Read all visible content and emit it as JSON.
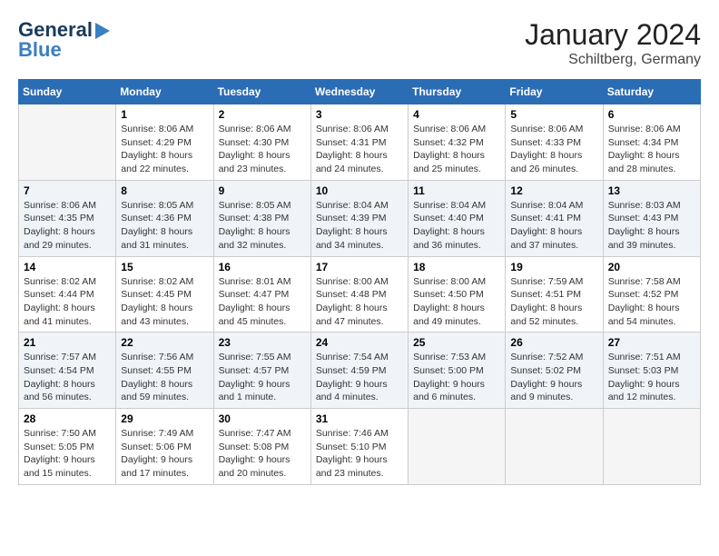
{
  "header": {
    "logo_line1": "General",
    "logo_line2": "Blue",
    "month_title": "January 2024",
    "location": "Schiltberg, Germany"
  },
  "days_of_week": [
    "Sunday",
    "Monday",
    "Tuesday",
    "Wednesday",
    "Thursday",
    "Friday",
    "Saturday"
  ],
  "weeks": [
    [
      {
        "day": "",
        "sunrise": "",
        "sunset": "",
        "daylight": "",
        "empty": true
      },
      {
        "day": "1",
        "sunrise": "Sunrise: 8:06 AM",
        "sunset": "Sunset: 4:29 PM",
        "daylight": "Daylight: 8 hours and 22 minutes."
      },
      {
        "day": "2",
        "sunrise": "Sunrise: 8:06 AM",
        "sunset": "Sunset: 4:30 PM",
        "daylight": "Daylight: 8 hours and 23 minutes."
      },
      {
        "day": "3",
        "sunrise": "Sunrise: 8:06 AM",
        "sunset": "Sunset: 4:31 PM",
        "daylight": "Daylight: 8 hours and 24 minutes."
      },
      {
        "day": "4",
        "sunrise": "Sunrise: 8:06 AM",
        "sunset": "Sunset: 4:32 PM",
        "daylight": "Daylight: 8 hours and 25 minutes."
      },
      {
        "day": "5",
        "sunrise": "Sunrise: 8:06 AM",
        "sunset": "Sunset: 4:33 PM",
        "daylight": "Daylight: 8 hours and 26 minutes."
      },
      {
        "day": "6",
        "sunrise": "Sunrise: 8:06 AM",
        "sunset": "Sunset: 4:34 PM",
        "daylight": "Daylight: 8 hours and 28 minutes."
      }
    ],
    [
      {
        "day": "7",
        "sunrise": "Sunrise: 8:06 AM",
        "sunset": "Sunset: 4:35 PM",
        "daylight": "Daylight: 8 hours and 29 minutes."
      },
      {
        "day": "8",
        "sunrise": "Sunrise: 8:05 AM",
        "sunset": "Sunset: 4:36 PM",
        "daylight": "Daylight: 8 hours and 31 minutes."
      },
      {
        "day": "9",
        "sunrise": "Sunrise: 8:05 AM",
        "sunset": "Sunset: 4:38 PM",
        "daylight": "Daylight: 8 hours and 32 minutes."
      },
      {
        "day": "10",
        "sunrise": "Sunrise: 8:04 AM",
        "sunset": "Sunset: 4:39 PM",
        "daylight": "Daylight: 8 hours and 34 minutes."
      },
      {
        "day": "11",
        "sunrise": "Sunrise: 8:04 AM",
        "sunset": "Sunset: 4:40 PM",
        "daylight": "Daylight: 8 hours and 36 minutes."
      },
      {
        "day": "12",
        "sunrise": "Sunrise: 8:04 AM",
        "sunset": "Sunset: 4:41 PM",
        "daylight": "Daylight: 8 hours and 37 minutes."
      },
      {
        "day": "13",
        "sunrise": "Sunrise: 8:03 AM",
        "sunset": "Sunset: 4:43 PM",
        "daylight": "Daylight: 8 hours and 39 minutes."
      }
    ],
    [
      {
        "day": "14",
        "sunrise": "Sunrise: 8:02 AM",
        "sunset": "Sunset: 4:44 PM",
        "daylight": "Daylight: 8 hours and 41 minutes."
      },
      {
        "day": "15",
        "sunrise": "Sunrise: 8:02 AM",
        "sunset": "Sunset: 4:45 PM",
        "daylight": "Daylight: 8 hours and 43 minutes."
      },
      {
        "day": "16",
        "sunrise": "Sunrise: 8:01 AM",
        "sunset": "Sunset: 4:47 PM",
        "daylight": "Daylight: 8 hours and 45 minutes."
      },
      {
        "day": "17",
        "sunrise": "Sunrise: 8:00 AM",
        "sunset": "Sunset: 4:48 PM",
        "daylight": "Daylight: 8 hours and 47 minutes."
      },
      {
        "day": "18",
        "sunrise": "Sunrise: 8:00 AM",
        "sunset": "Sunset: 4:50 PM",
        "daylight": "Daylight: 8 hours and 49 minutes."
      },
      {
        "day": "19",
        "sunrise": "Sunrise: 7:59 AM",
        "sunset": "Sunset: 4:51 PM",
        "daylight": "Daylight: 8 hours and 52 minutes."
      },
      {
        "day": "20",
        "sunrise": "Sunrise: 7:58 AM",
        "sunset": "Sunset: 4:52 PM",
        "daylight": "Daylight: 8 hours and 54 minutes."
      }
    ],
    [
      {
        "day": "21",
        "sunrise": "Sunrise: 7:57 AM",
        "sunset": "Sunset: 4:54 PM",
        "daylight": "Daylight: 8 hours and 56 minutes."
      },
      {
        "day": "22",
        "sunrise": "Sunrise: 7:56 AM",
        "sunset": "Sunset: 4:55 PM",
        "daylight": "Daylight: 8 hours and 59 minutes."
      },
      {
        "day": "23",
        "sunrise": "Sunrise: 7:55 AM",
        "sunset": "Sunset: 4:57 PM",
        "daylight": "Daylight: 9 hours and 1 minute."
      },
      {
        "day": "24",
        "sunrise": "Sunrise: 7:54 AM",
        "sunset": "Sunset: 4:59 PM",
        "daylight": "Daylight: 9 hours and 4 minutes."
      },
      {
        "day": "25",
        "sunrise": "Sunrise: 7:53 AM",
        "sunset": "Sunset: 5:00 PM",
        "daylight": "Daylight: 9 hours and 6 minutes."
      },
      {
        "day": "26",
        "sunrise": "Sunrise: 7:52 AM",
        "sunset": "Sunset: 5:02 PM",
        "daylight": "Daylight: 9 hours and 9 minutes."
      },
      {
        "day": "27",
        "sunrise": "Sunrise: 7:51 AM",
        "sunset": "Sunset: 5:03 PM",
        "daylight": "Daylight: 9 hours and 12 minutes."
      }
    ],
    [
      {
        "day": "28",
        "sunrise": "Sunrise: 7:50 AM",
        "sunset": "Sunset: 5:05 PM",
        "daylight": "Daylight: 9 hours and 15 minutes."
      },
      {
        "day": "29",
        "sunrise": "Sunrise: 7:49 AM",
        "sunset": "Sunset: 5:06 PM",
        "daylight": "Daylight: 9 hours and 17 minutes."
      },
      {
        "day": "30",
        "sunrise": "Sunrise: 7:47 AM",
        "sunset": "Sunset: 5:08 PM",
        "daylight": "Daylight: 9 hours and 20 minutes."
      },
      {
        "day": "31",
        "sunrise": "Sunrise: 7:46 AM",
        "sunset": "Sunset: 5:10 PM",
        "daylight": "Daylight: 9 hours and 23 minutes."
      },
      {
        "day": "",
        "sunrise": "",
        "sunset": "",
        "daylight": "",
        "empty": true
      },
      {
        "day": "",
        "sunrise": "",
        "sunset": "",
        "daylight": "",
        "empty": true
      },
      {
        "day": "",
        "sunrise": "",
        "sunset": "",
        "daylight": "",
        "empty": true
      }
    ]
  ]
}
